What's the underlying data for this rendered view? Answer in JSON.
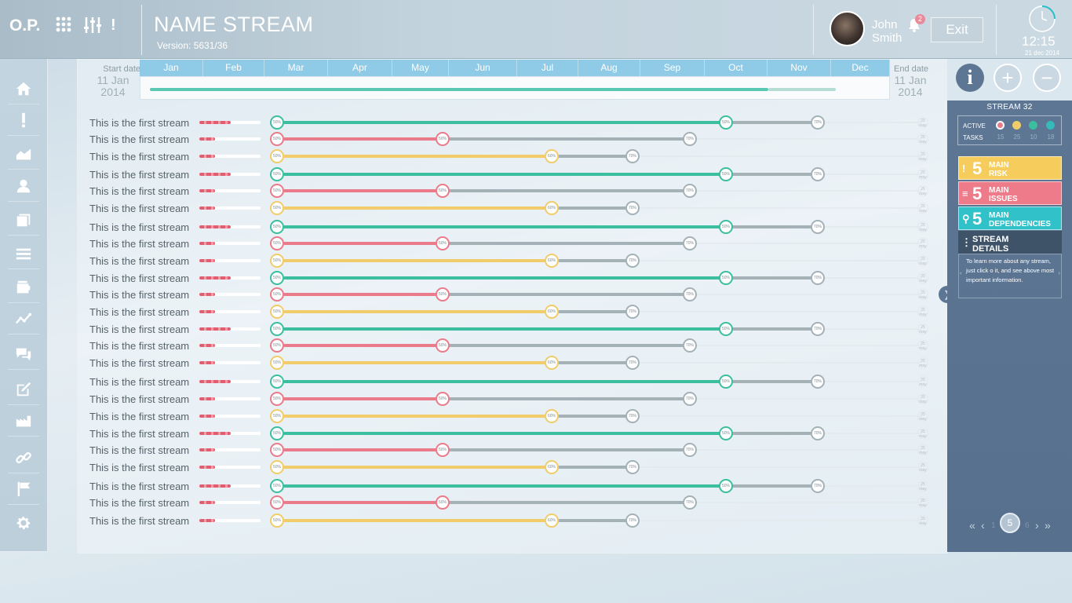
{
  "header": {
    "logo": "O.P.",
    "title": "NAME STREAM",
    "version": "Version: 5631/36",
    "user_first": "John",
    "user_last": "Smith",
    "notifications": "2",
    "exit_label": "Exit",
    "time": "12:15",
    "date": "21 dec 2014"
  },
  "timeline": {
    "start_label": "Start date",
    "start_date_line1": "11 Jan",
    "start_date_line2": "2014",
    "end_label": "End date",
    "end_date_line1": "11 Jan",
    "end_date_line2": "2014",
    "months": [
      "Jan",
      "Feb",
      "Mar",
      "Apr",
      "May",
      "Jun",
      "Jul",
      "Aug",
      "Sep",
      "Oct",
      "Nov",
      "Dec"
    ]
  },
  "stream_label": "This is the first stream",
  "row_patterns": [
    {
      "color": "#3bbf9e",
      "mid_pct": "50%",
      "mid_label": "50%",
      "end_label": "70%"
    },
    {
      "color": "#ea7b8a",
      "mid_pct": "50%",
      "mid_label": "50%",
      "end_label": "70%"
    },
    {
      "color": "#f1cc6a",
      "mid_pct": "50%",
      "mid_label": "60%",
      "end_label": "70%"
    }
  ],
  "end_marker": "25 may",
  "rows": 24,
  "panel": {
    "stream_title": "STREAM 32",
    "active_label": "ACTIVE",
    "tasks_label": "TASKS",
    "dots": [
      {
        "color": "#ea7b8a",
        "count": "15"
      },
      {
        "color": "#f1cc6a",
        "count": "25"
      },
      {
        "color": "#3bbf9e",
        "count": "10"
      },
      {
        "color": "#35b9b9",
        "count": "18"
      }
    ],
    "cards": [
      {
        "num": "5",
        "line1": "MAIN",
        "line2": "RISK",
        "color": "#f6cd5c",
        "icon": "!"
      },
      {
        "num": "5",
        "line1": "MAIN",
        "line2": "ISSUES",
        "color": "#ee7b8a",
        "icon": "≡"
      },
      {
        "num": "5",
        "line1": "MAIN",
        "line2": "DEPENDENCIES",
        "color": "#31c1c9",
        "icon": "⚲"
      },
      {
        "num": "",
        "line1": "STREAM",
        "line2": "DETAILS",
        "color": "#3e5268",
        "icon": "⋮"
      }
    ],
    "info_text": "To learn more about any stream, just click o it, and see above most important information.",
    "pager": {
      "prev_first": "«",
      "prev": "‹",
      "before": "1",
      "current": "5",
      "after": "6",
      "next": "›",
      "next_last": "»"
    }
  },
  "colors": {
    "accent": "#8fcbe6",
    "teal": "#3bbf9e",
    "red": "#ea7b8a",
    "yellow": "#f1cc6a",
    "gray_line": "#a4b2b8"
  }
}
